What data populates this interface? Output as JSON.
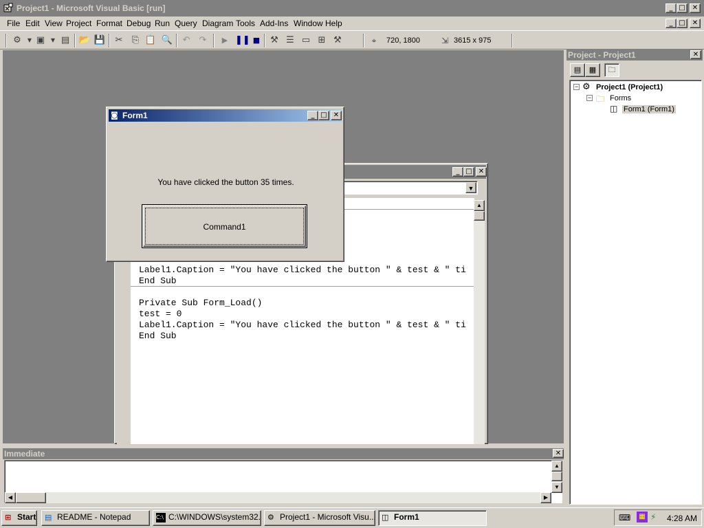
{
  "window": {
    "title": "Project1 - Microsoft Visual Basic [run]",
    "min": "_",
    "max": "□",
    "close": "✕"
  },
  "menu": [
    "File",
    "Edit",
    "View",
    "Project",
    "Format",
    "Debug",
    "Run",
    "Query",
    "Diagram",
    "Tools",
    "Add-Ins",
    "Window",
    "Help"
  ],
  "toolbar": {
    "position": "720, 1800",
    "size": "3615 x 975"
  },
  "form1": {
    "title": "Form1",
    "label_caption": "You have clicked the button 35 times.",
    "button_caption": "Command1"
  },
  "code": {
    "lines_a": [
      "Label1.Caption = \"You have clicked the button \" & test & \" ti",
      "End Sub"
    ],
    "lines_b": [
      "Private Sub Form_Load()",
      "test = 0",
      "Label1.Caption = \"You have clicked the button \" & test & \" ti",
      "End Sub"
    ]
  },
  "project": {
    "title": "Project - Project1",
    "root": "Project1 (Project1)",
    "folder": "Forms",
    "form": "Form1 (Form1)"
  },
  "immediate": {
    "title": "Immediate"
  },
  "taskbar": {
    "start": "Start",
    "tasks": [
      "README - Notepad",
      "C:\\WINDOWS\\system32...",
      "Project1 - Microsoft Visu...",
      "Form1"
    ],
    "clock": "4:28 AM"
  }
}
